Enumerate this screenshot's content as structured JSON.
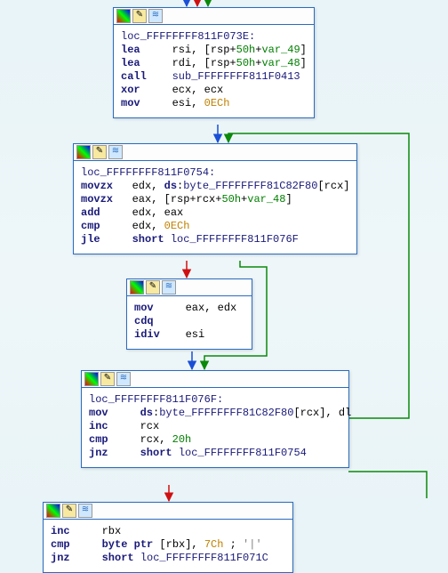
{
  "icons": {
    "palette": "pal",
    "edit": "ed",
    "graph": "gr"
  },
  "blocks": {
    "b1": {
      "label": "loc_FFFFFFFF811F073E:",
      "lines": [
        {
          "mn": "lea",
          "ops": [
            {
              "t": "op",
              "v": "rsi, [rsp+"
            },
            {
              "t": "num",
              "v": "50h"
            },
            {
              "t": "op",
              "v": "+"
            },
            {
              "t": "var",
              "v": "var_49"
            },
            {
              "t": "op",
              "v": "]"
            }
          ]
        },
        {
          "mn": "lea",
          "ops": [
            {
              "t": "op",
              "v": "rdi, [rsp+"
            },
            {
              "t": "num",
              "v": "50h"
            },
            {
              "t": "op",
              "v": "+"
            },
            {
              "t": "var",
              "v": "var_48"
            },
            {
              "t": "op",
              "v": "]"
            }
          ]
        },
        {
          "mn": "call",
          "ops": [
            {
              "t": "lbl",
              "v": "sub_FFFFFFFF811F0413"
            }
          ]
        },
        {
          "mn": "xor",
          "ops": [
            {
              "t": "op",
              "v": "ecx, ecx"
            }
          ]
        },
        {
          "mn": "mov",
          "ops": [
            {
              "t": "op",
              "v": "esi, "
            },
            {
              "t": "imm",
              "v": "0ECh"
            }
          ]
        }
      ]
    },
    "b2": {
      "label": "loc_FFFFFFFF811F0754:",
      "lines": [
        {
          "mn": "movzx",
          "ops": [
            {
              "t": "op",
              "v": "edx, "
            },
            {
              "t": "kw",
              "v": "ds"
            },
            {
              "t": "op",
              "v": ":"
            },
            {
              "t": "lbl",
              "v": "byte_FFFFFFFF81C82F80"
            },
            {
              "t": "op",
              "v": "[rcx]"
            }
          ]
        },
        {
          "mn": "movzx",
          "ops": [
            {
              "t": "op",
              "v": "eax, [rsp+rcx+"
            },
            {
              "t": "num",
              "v": "50h"
            },
            {
              "t": "op",
              "v": "+"
            },
            {
              "t": "var",
              "v": "var_48"
            },
            {
              "t": "op",
              "v": "]"
            }
          ]
        },
        {
          "mn": "add",
          "ops": [
            {
              "t": "op",
              "v": "edx, eax"
            }
          ]
        },
        {
          "mn": "cmp",
          "ops": [
            {
              "t": "op",
              "v": "edx, "
            },
            {
              "t": "imm",
              "v": "0ECh"
            }
          ]
        },
        {
          "mn": "jle",
          "ops": [
            {
              "t": "kw",
              "v": "short"
            },
            {
              "t": "op",
              "v": " "
            },
            {
              "t": "lbl",
              "v": "loc_FFFFFFFF811F076F"
            }
          ]
        }
      ]
    },
    "b3": {
      "label": "",
      "lines": [
        {
          "mn": "mov",
          "ops": [
            {
              "t": "op",
              "v": "eax, edx"
            }
          ]
        },
        {
          "mn": "cdq",
          "ops": []
        },
        {
          "mn": "idiv",
          "ops": [
            {
              "t": "op",
              "v": "esi"
            }
          ]
        }
      ]
    },
    "b4": {
      "label": "loc_FFFFFFFF811F076F:",
      "lines": [
        {
          "mn": "mov",
          "ops": [
            {
              "t": "kw",
              "v": "ds"
            },
            {
              "t": "op",
              "v": ":"
            },
            {
              "t": "lbl",
              "v": "byte_FFFFFFFF81C82F80"
            },
            {
              "t": "op",
              "v": "[rcx], dl"
            }
          ]
        },
        {
          "mn": "inc",
          "ops": [
            {
              "t": "op",
              "v": "rcx"
            }
          ]
        },
        {
          "mn": "cmp",
          "ops": [
            {
              "t": "op",
              "v": "rcx, "
            },
            {
              "t": "num",
              "v": "20h"
            }
          ]
        },
        {
          "mn": "jnz",
          "ops": [
            {
              "t": "kw",
              "v": "short"
            },
            {
              "t": "op",
              "v": " "
            },
            {
              "t": "lbl",
              "v": "loc_FFFFFFFF811F0754"
            }
          ]
        }
      ]
    },
    "b5": {
      "label": "",
      "lines": [
        {
          "mn": "inc",
          "ops": [
            {
              "t": "op",
              "v": "rbx"
            }
          ]
        },
        {
          "mn": "cmp",
          "ops": [
            {
              "t": "kw",
              "v": "byte ptr"
            },
            {
              "t": "op",
              "v": " [rbx], "
            },
            {
              "t": "imm",
              "v": "7Ch"
            },
            {
              "t": "op",
              "v": " ; "
            },
            {
              "t": "cmt",
              "v": "'|'"
            }
          ]
        },
        {
          "mn": "jnz",
          "ops": [
            {
              "t": "kw",
              "v": "short"
            },
            {
              "t": "op",
              "v": " "
            },
            {
              "t": "lbl",
              "v": "loc_FFFFFFFF811F071C"
            }
          ]
        }
      ]
    }
  }
}
